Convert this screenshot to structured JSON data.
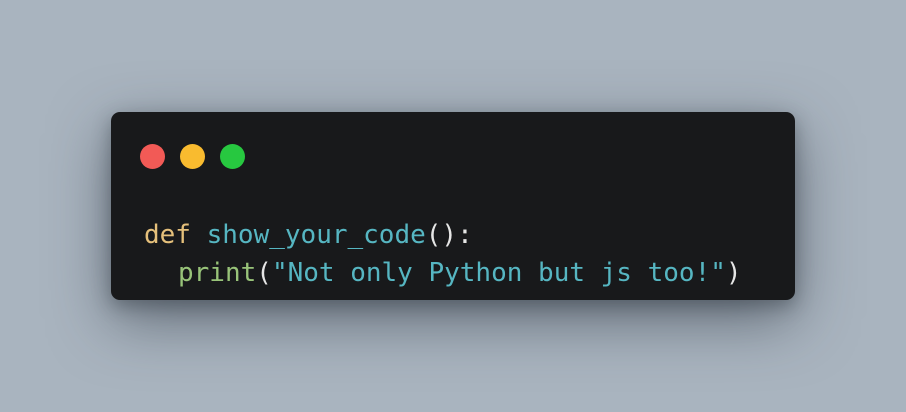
{
  "window": {
    "controls": [
      {
        "name": "close",
        "color": "#f25a56"
      },
      {
        "name": "minimize",
        "color": "#f9bb2f"
      },
      {
        "name": "zoom",
        "color": "#27c840"
      }
    ]
  },
  "code": {
    "line1": {
      "keyword": "def",
      "space": " ",
      "function_name": "show_your_code",
      "parens": "()",
      "colon": ":"
    },
    "line2": {
      "builtin": "print",
      "open_paren": "(",
      "string": "\"Not only Python but js too!\"",
      "close_paren": ")"
    }
  },
  "colors": {
    "background": "#a9b4bf",
    "window_bg": "#18191b",
    "keyword": "#e5c07b",
    "function_name": "#56b6c2",
    "builtin": "#98c379",
    "string": "#56b6c2",
    "punctuation": "#e6e6e6"
  }
}
